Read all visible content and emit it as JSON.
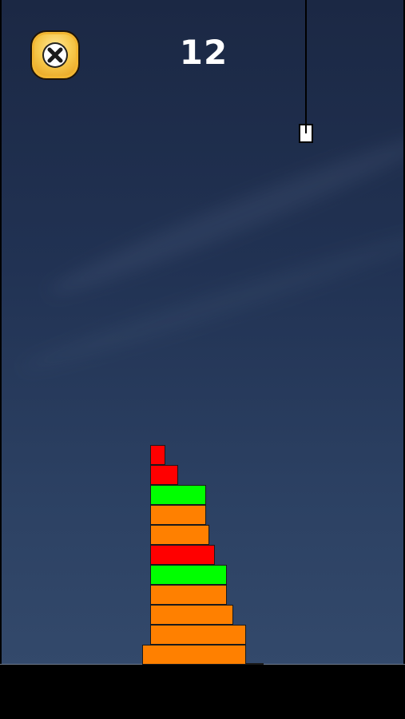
{
  "hud": {
    "score": "12"
  },
  "icons": {
    "close": "close-icon"
  },
  "colors": {
    "orange": "#ff8000",
    "green": "#00ff00",
    "red": "#ff0000",
    "hook": "#ffffff",
    "rope": "#000000"
  },
  "tower": {
    "blocks_bottom_to_top": [
      {
        "color": "orange"
      },
      {
        "color": "orange"
      },
      {
        "color": "orange"
      },
      {
        "color": "orange"
      },
      {
        "color": "green"
      },
      {
        "color": "red"
      },
      {
        "color": "orange"
      },
      {
        "color": "orange"
      },
      {
        "color": "green"
      },
      {
        "color": "red"
      },
      {
        "color": "red"
      }
    ]
  }
}
